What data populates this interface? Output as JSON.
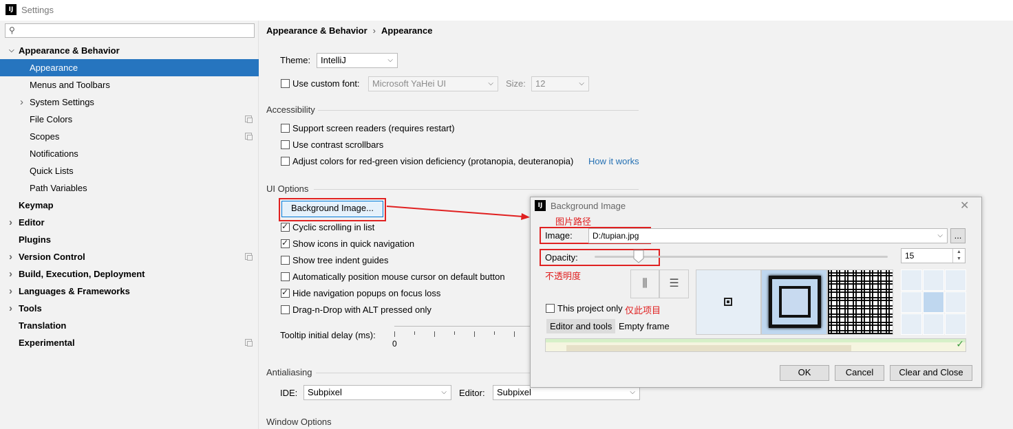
{
  "window": {
    "title": "Settings",
    "app_icon": "IJ"
  },
  "sidebar": {
    "search_placeholder": "",
    "items": [
      {
        "label": "Appearance & Behavior",
        "level": 0,
        "expanded": true,
        "bold": true
      },
      {
        "label": "Appearance",
        "level": 1,
        "selected": true
      },
      {
        "label": "Menus and Toolbars",
        "level": 1
      },
      {
        "label": "System Settings",
        "level": 1,
        "collapsible": true
      },
      {
        "label": "File Colors",
        "level": 1,
        "project_icon": true
      },
      {
        "label": "Scopes",
        "level": 1,
        "project_icon": true
      },
      {
        "label": "Notifications",
        "level": 1
      },
      {
        "label": "Quick Lists",
        "level": 1
      },
      {
        "label": "Path Variables",
        "level": 1
      },
      {
        "label": "Keymap",
        "level": 0,
        "bold": true
      },
      {
        "label": "Editor",
        "level": 0,
        "bold": true,
        "collapsible": true
      },
      {
        "label": "Plugins",
        "level": 0,
        "bold": true
      },
      {
        "label": "Version Control",
        "level": 0,
        "bold": true,
        "collapsible": true,
        "project_icon": true
      },
      {
        "label": "Build, Execution, Deployment",
        "level": 0,
        "bold": true,
        "collapsible": true
      },
      {
        "label": "Languages & Frameworks",
        "level": 0,
        "bold": true,
        "collapsible": true
      },
      {
        "label": "Tools",
        "level": 0,
        "bold": true,
        "collapsible": true
      },
      {
        "label": "Translation",
        "level": 0,
        "bold": true
      },
      {
        "label": "Experimental",
        "level": 0,
        "bold": true,
        "project_icon": true
      }
    ]
  },
  "breadcrumb": {
    "parent": "Appearance & Behavior",
    "sep": "›",
    "current": "Appearance"
  },
  "appearance": {
    "theme_label": "Theme:",
    "theme_value": "IntelliJ",
    "custom_font_label": "Use custom font:",
    "custom_font_checked": false,
    "font_value": "Microsoft YaHei UI",
    "size_label": "Size:",
    "size_value": "12"
  },
  "accessibility": {
    "title": "Accessibility",
    "options": [
      {
        "label": "Support screen readers (requires restart)",
        "checked": false
      },
      {
        "label": "Use contrast scrollbars",
        "checked": false
      },
      {
        "label": "Adjust colors for red-green vision deficiency (protanopia, deuteranopia)",
        "checked": false
      }
    ],
    "how_it_works": "How it works"
  },
  "ui_options": {
    "title": "UI Options",
    "bg_image_button": "Background Image...",
    "options": [
      {
        "label": "Cyclic scrolling in list",
        "checked": true
      },
      {
        "label": "Show icons in quick navigation",
        "checked": true
      },
      {
        "label": "Show tree indent guides",
        "checked": false
      },
      {
        "label": "Automatically position mouse cursor on default button",
        "checked": false
      },
      {
        "label": "Hide navigation popups on focus loss",
        "checked": true
      },
      {
        "label": "Drag-n-Drop with ALT pressed only",
        "checked": false
      }
    ],
    "tooltip_label": "Tooltip initial delay (ms):",
    "tooltip_min": "0"
  },
  "antialiasing": {
    "title": "Antialiasing",
    "ide_label": "IDE:",
    "ide_value": "Subpixel",
    "editor_label": "Editor:",
    "editor_value": "Subpixel"
  },
  "window_options": {
    "title": "Window Options"
  },
  "dialog": {
    "title": "Background Image",
    "image_label": "Image:",
    "image_value": "D:/tupian.jpg",
    "browse_label": "...",
    "opacity_label": "Opacity:",
    "opacity_value": "15",
    "opacity_fraction": 0.15,
    "project_only_label": "This project only",
    "project_only_checked": false,
    "tab_editor": "Editor and tools",
    "tab_empty": "Empty frame",
    "ok": "OK",
    "cancel": "Cancel",
    "clear_close": "Clear and Close"
  },
  "annotations": {
    "image_path": "图片路径",
    "opacity": "不透明度",
    "project_only": "仅此项目"
  },
  "colors": {
    "selection": "#2675bf",
    "annotation_red": "#e02020",
    "link": "#2470b3"
  }
}
